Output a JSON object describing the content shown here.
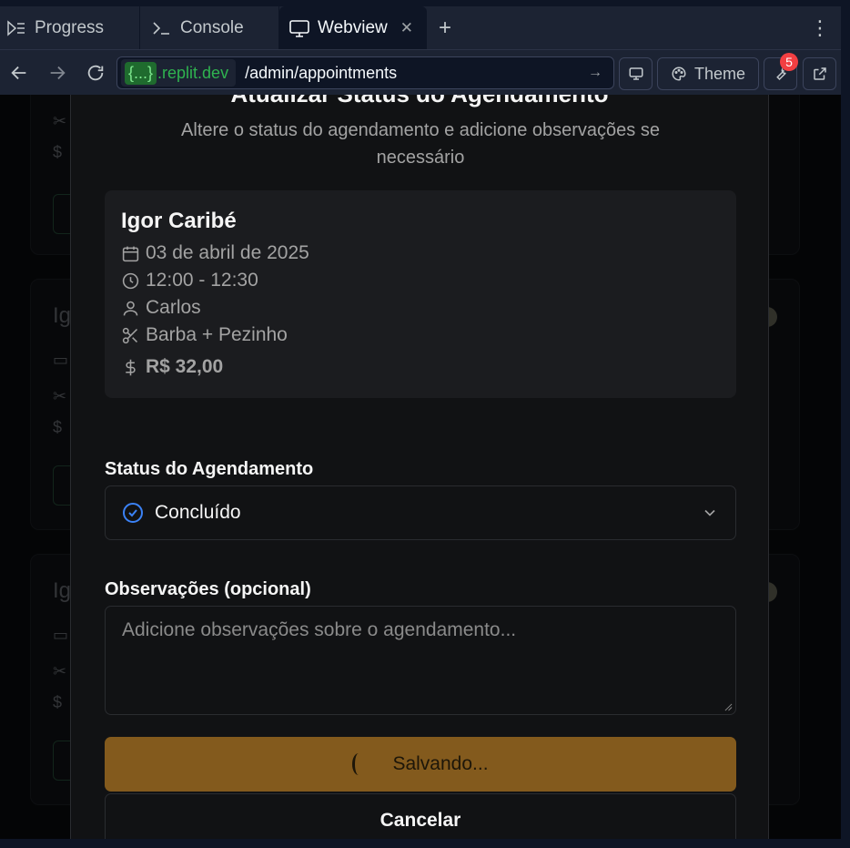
{
  "tabs": [
    {
      "label": "Progress",
      "icon": "progress-icon"
    },
    {
      "label": "Console",
      "icon": "console-icon"
    },
    {
      "label": "Webview",
      "icon": "monitor-icon",
      "active": true
    }
  ],
  "addressbar": {
    "host_badge": "{...}",
    "host": ".replit.dev",
    "path": "/admin/appointments",
    "theme_label": "Theme",
    "notification_count": "5"
  },
  "background_cards": [
    {
      "name": "Ig"
    },
    {
      "name": "Ig"
    }
  ],
  "dialog": {
    "title": "Atualizar Status do Agendamento",
    "subtitle": "Altere o status do agendamento e adicione observações se necessário",
    "appointment": {
      "client": "Igor Caribé",
      "date": "03 de abril de 2025",
      "time": "12:00 - 12:30",
      "barber": "Carlos",
      "service": "Barba + Pezinho",
      "price": "R$ 32,00"
    },
    "status_label": "Status do Agendamento",
    "status_value": "Concluído",
    "notes_label": "Observações (opcional)",
    "notes_placeholder": "Adicione observações sobre o agendamento...",
    "save_label": "Salvando...",
    "cancel_label": "Cancelar"
  },
  "colors": {
    "save_button": "#835a1d",
    "status_icon": "#3b82f6",
    "host_green": "#2fb34f",
    "notification": "#f23f42"
  }
}
